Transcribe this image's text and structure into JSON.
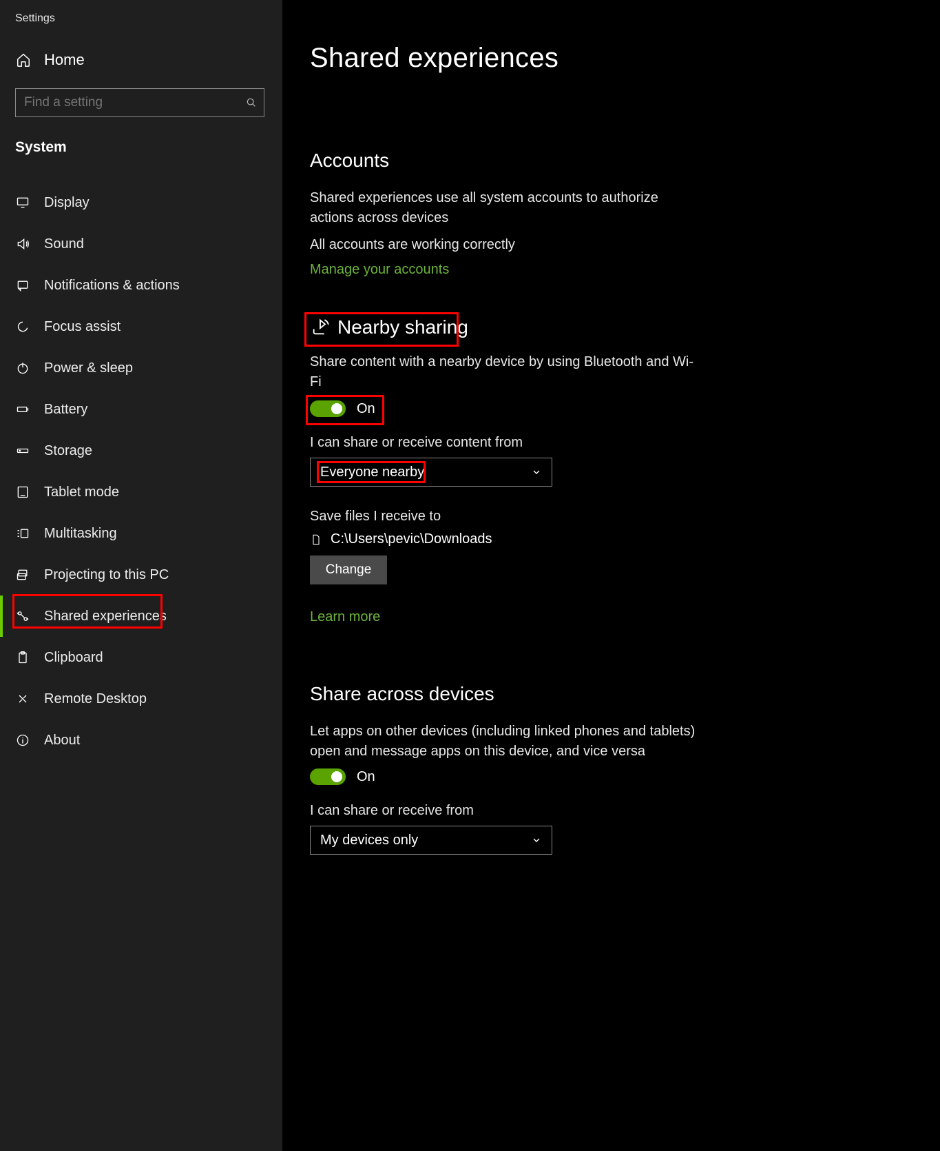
{
  "app_title": "Settings",
  "home_label": "Home",
  "search_placeholder": "Find a setting",
  "category_label": "System",
  "nav": [
    {
      "label": "Display",
      "icon": "display"
    },
    {
      "label": "Sound",
      "icon": "sound"
    },
    {
      "label": "Notifications & actions",
      "icon": "notifications"
    },
    {
      "label": "Focus assist",
      "icon": "focus"
    },
    {
      "label": "Power & sleep",
      "icon": "power"
    },
    {
      "label": "Battery",
      "icon": "battery"
    },
    {
      "label": "Storage",
      "icon": "storage"
    },
    {
      "label": "Tablet mode",
      "icon": "tablet"
    },
    {
      "label": "Multitasking",
      "icon": "multitasking"
    },
    {
      "label": "Projecting to this PC",
      "icon": "projecting"
    },
    {
      "label": "Shared experiences",
      "icon": "shared",
      "active": true
    },
    {
      "label": "Clipboard",
      "icon": "clipboard"
    },
    {
      "label": "Remote Desktop",
      "icon": "remote"
    },
    {
      "label": "About",
      "icon": "about"
    }
  ],
  "page_title": "Shared experiences",
  "accounts": {
    "heading": "Accounts",
    "desc": "Shared experiences use all system accounts to authorize actions across devices",
    "status": "All accounts are working correctly",
    "manage_link": "Manage your accounts"
  },
  "nearby": {
    "heading": "Nearby sharing",
    "desc": "Share content with a nearby device by using Bluetooth and Wi-Fi",
    "toggle_state": "On",
    "share_from_label": "I can share or receive content from",
    "share_from_value": "Everyone nearby",
    "save_to_label": "Save files I receive to",
    "save_to_path": "C:\\Users\\pevic\\Downloads",
    "change_label": "Change",
    "learn_more": "Learn more"
  },
  "across": {
    "heading": "Share across devices",
    "desc": "Let apps on other devices (including linked phones and tablets) open and message apps on this device, and vice versa",
    "toggle_state": "On",
    "share_from_label": "I can share or receive from",
    "share_from_value": "My devices only"
  }
}
